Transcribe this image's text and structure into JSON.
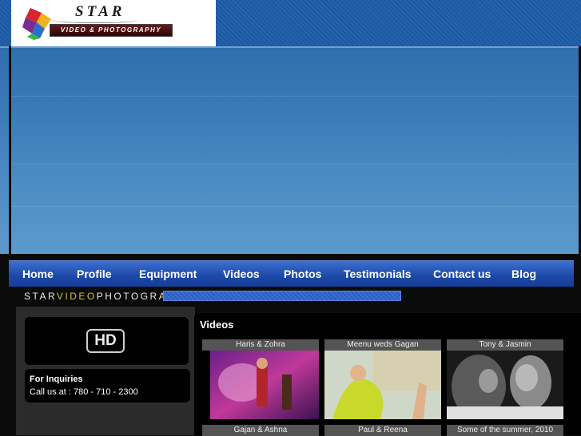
{
  "logo": {
    "title": "STAR",
    "subtitle": "VIDEO & PHOTOGRAPHY"
  },
  "nav": {
    "items": [
      "Home",
      "Profile",
      "Equipment",
      "Videos",
      "Photos",
      "Testimonials",
      "Contact us",
      "Blog"
    ]
  },
  "tagline": {
    "part1": "STAR",
    "part2": "VIDEO",
    "part3": "PHOTOGRAPHY"
  },
  "hd_badge": "HD",
  "inquiries": {
    "title": "For Inquiries",
    "phone": "Call us at : 780 - 710 - 2300"
  },
  "videos": {
    "heading": "Videos",
    "cards": [
      {
        "title": "Haris & Zohra"
      },
      {
        "title": "Meenu weds Gagan"
      },
      {
        "title": "Tony & Jasmin"
      },
      {
        "title": "Gajan & Ashna"
      },
      {
        "title": "Paul & Reena"
      },
      {
        "title": "Some of the summer, 2010"
      }
    ]
  },
  "colors": {
    "nav_blue": "#1c48a8",
    "banner_blue": "#3a7bb6",
    "tagline_accent": "#c9c330"
  }
}
